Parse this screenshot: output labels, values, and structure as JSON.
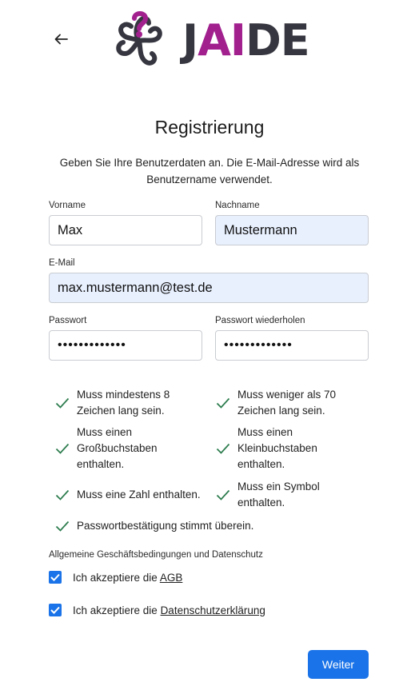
{
  "header": {
    "back_icon": "arrow-left-icon",
    "logo": {
      "word_a": "J",
      "word_ai": "AI",
      "word_b": "DE",
      "icon": "flower-question-logo-icon",
      "accent": "#a1208e",
      "text_color": "#363640"
    }
  },
  "title": "Registrierung",
  "intro": "Geben Sie Ihre Benutzerdaten an. Die E-Mail-Adresse wird als Benutzername verwendet.",
  "form": {
    "first_name": {
      "label": "Vorname",
      "value": "Max"
    },
    "last_name": {
      "label": "Nachname",
      "value": "Mustermann"
    },
    "email": {
      "label": "E-Mail",
      "value": "max.mustermann@test.de"
    },
    "password": {
      "label": "Passwort",
      "value": "•••••••••••••"
    },
    "password_repeat": {
      "label": "Passwort wiederholen",
      "value": "•••••••••••••"
    }
  },
  "rules": {
    "min_length": "Muss mindestens 8 Zeichen lang sein.",
    "max_length": "Muss weniger als 70 Zeichen lang sein.",
    "uppercase": "Muss einen Großbuchstaben enthalten.",
    "lowercase": "Muss einen Kleinbuchstaben enthalten.",
    "number": "Muss eine Zahl enthalten.",
    "symbol": "Muss ein Symbol enthalten.",
    "confirm": "Passwortbestätigung stimmt überein."
  },
  "terms": {
    "heading": "Allgemeine Geschäftsbedingungen und Datenschutz",
    "agb_prefix": "Ich akzeptiere die ",
    "agb_link": "AGB",
    "privacy_prefix": "Ich akzeptiere die ",
    "privacy_link": "Datenschutzerklärung"
  },
  "submit_label": "Weiter",
  "colors": {
    "primary": "#1a73e8",
    "check": "#2e7d4f",
    "autofill": "#e8f0fe"
  }
}
